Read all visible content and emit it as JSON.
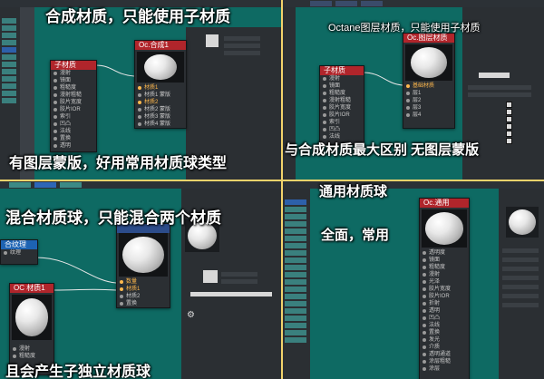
{
  "panel1": {
    "annotation_top": "合成材质，只能使用子材质",
    "annotation_bottom": "有图层蒙版，好用常用材质球类型"
  },
  "panel2": {
    "annotation_top": "Octane图层材质，只能使用子材质",
    "annotation_bottom": "与合成材质最大区别   无图层蒙版"
  },
  "panel3": {
    "annotation_top": "混合材质球，只能混合两个材质",
    "annotation_bottom": "且会产生子独立材质球"
  },
  "panel4": {
    "annotation_top": "通用材质球",
    "annotation_middle": "全面，常用"
  },
  "colors": {
    "canvas": "#0e6a63",
    "divider": "#f2d36b",
    "node_header_red": "#b0252b",
    "node_header_blue": "#1d63b3"
  }
}
